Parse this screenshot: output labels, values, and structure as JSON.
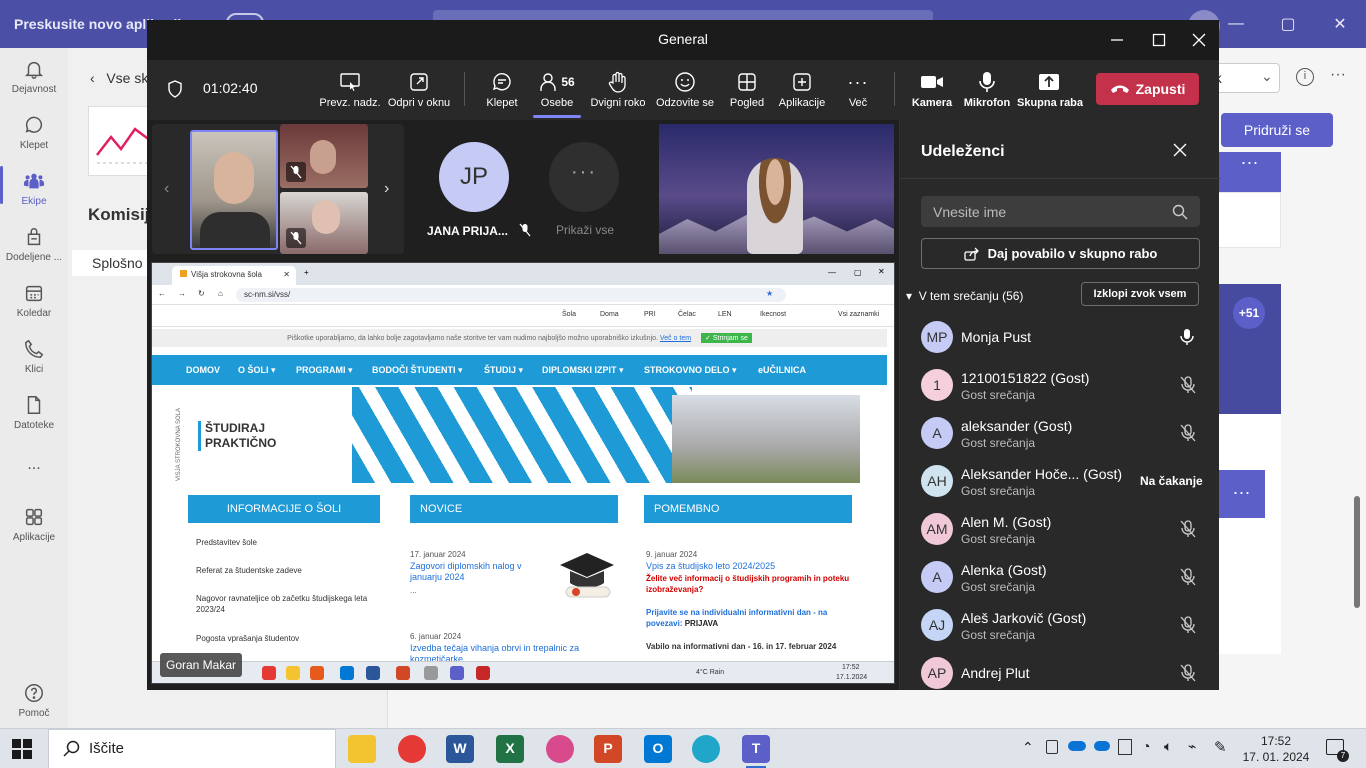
{
  "background": {
    "banner": "Preskusite novo aplikacijo",
    "rail": [
      {
        "label": "Dejavnost",
        "icon": "bell-icon"
      },
      {
        "label": "Klepet",
        "icon": "chat-icon"
      },
      {
        "label": "Ekipe",
        "icon": "teams-icon"
      },
      {
        "label": "Dodeljene ...",
        "icon": "assignments-icon"
      },
      {
        "label": "Koledar",
        "icon": "calendar-icon"
      },
      {
        "label": "Klici",
        "icon": "phone-icon"
      },
      {
        "label": "Datoteke",
        "icon": "file-icon"
      },
      {
        "label": "...",
        "icon": "more-icon"
      },
      {
        "label": "Aplikacije",
        "icon": "apps-icon"
      },
      {
        "label": "Pomoč",
        "icon": "help-icon"
      }
    ],
    "back_label": "Vse sk",
    "team_title": "Komisij",
    "channel_label": "Splošno",
    "right_btn_label": "ek",
    "join_label": "Pridruži se",
    "plus_count": "+51"
  },
  "meeting": {
    "window_title": "General",
    "timer": "01:02:40",
    "toolbar": {
      "take_control": "Prevz. nadz.",
      "pop_out": "Odpri v oknu",
      "chat": "Klepet",
      "people": "Osebe",
      "people_count": "56",
      "raise_hand": "Dvigni roko",
      "react": "Odzovite se",
      "view": "Pogled",
      "apps": "Aplikacije",
      "more": "Več",
      "camera": "Kamera",
      "mic": "Mikrofon",
      "share": "Skupna raba",
      "leave": "Zapusti"
    },
    "tiles": {
      "jp_initials": "JP",
      "jp_name": "JANA PRIJA...",
      "show_all": "Prikaži vse",
      "show_all_dots": "···"
    },
    "presenter_name": "Goran Makar",
    "shared_screen": {
      "tab_title": "Višja strokovna šola",
      "url": "sc-nm.si/vss/",
      "bookmarks": [
        "Šola",
        "Doma",
        "PRI",
        "Čelac",
        "LEN",
        "Ikecnost",
        "Vsi zaznamki"
      ],
      "cookie_text": "Piškotke uporabljamo, da lahko bolje zagotavljamo naše storitve ter vam nudimo najboljšo možno uporabniško izkušnjo.",
      "cookie_link": "Več o tem",
      "cookie_ok": "✓ Strinjam se",
      "nav": [
        "DOMOV",
        "O ŠOLI ▾",
        "PROGRAMI ▾",
        "BODOČI ŠTUDENTI ▾",
        "ŠTUDIJ ▾",
        "DIPLOMSKI IZPIT ▾",
        "STROKOVNO DELO ▾",
        "eUČILNICA"
      ],
      "hero_line1": "ŠTUDIRAJ",
      "hero_line2": "PRAKTIČNO",
      "hero_vertical": "VIŠJA STROKOVNA ŠOLA",
      "col1_title": "INFORMACIJE O ŠOLI",
      "col1_items": [
        "Predstavitev šole",
        "Referat za študentske zadeve",
        "Nagovor ravnateljice ob začetku študijskega leta 2023/24",
        "Pogosta vprašanja študentov"
      ],
      "col2_title": "NOVICE",
      "news": [
        {
          "date": "17. januar 2024",
          "title": "Zagovori diplomskih nalog v januarju 2024",
          "more": "..."
        },
        {
          "date": "6. januar 2024",
          "title": "Izvedba tečaja vihanja obrvi in trepalnic za kozmetičarke"
        }
      ],
      "col3_title": "POMEMBNO",
      "important": {
        "date": "9. januar 2024",
        "title": "Vpis za študijsko leto 2024/2025",
        "red": "Želite več informacij o študijskih programih in poteku izobraževanja?",
        "blue": "Prijavite se na individualni informativni dan - na povezavi:",
        "blue_link": "PRIJAVA",
        "bold": "Vabilo na informativni dan - 16. in 17. februar 2024"
      },
      "taskbar_weather": "4°C Rain",
      "taskbar_time": "17:52",
      "taskbar_date": "17.1.2024"
    },
    "participants_panel": {
      "title": "Udeleženci",
      "search_placeholder": "Vnesite ime",
      "invite": "Daj povabilo v skupno rabo",
      "section": "V tem srečanju (56)",
      "mute_all": "Izklopi zvok vsem",
      "people": [
        {
          "initials": "MP",
          "name": "Monja Pust",
          "sub": "",
          "status": "mic-on",
          "color": "#c5cbf5"
        },
        {
          "initials": "1",
          "name": "12100151822 (Gost)",
          "sub": "Gost srečanja",
          "status": "mic-off",
          "color": "#f5d0dc"
        },
        {
          "initials": "A",
          "name": "aleksander (Gost)",
          "sub": "Gost srečanja",
          "status": "mic-off",
          "color": "#c5cbf5"
        },
        {
          "initials": "AH",
          "name": "Aleksander Hoče... (Gost)",
          "sub": "Gost srečanja",
          "status": "Na čakanje",
          "color": "#d0e4f0"
        },
        {
          "initials": "AM",
          "name": "Alen M. (Gost)",
          "sub": "Gost srečanja",
          "status": "mic-off",
          "color": "#f0c8d8"
        },
        {
          "initials": "A",
          "name": "Alenka (Gost)",
          "sub": "Gost srečanja",
          "status": "mic-off",
          "color": "#c5cbf5"
        },
        {
          "initials": "AJ",
          "name": "Aleš Jarkovič (Gost)",
          "sub": "Gost srečanja",
          "status": "mic-off",
          "color": "#c5d5f5"
        },
        {
          "initials": "AP",
          "name": "Andrej Plut",
          "sub": "",
          "status": "mic-off",
          "color": "#f0c8d8"
        }
      ]
    }
  },
  "taskbar": {
    "search_label": "Iščite",
    "apps": [
      {
        "name": "file-explorer",
        "letter": "",
        "color": "#f4c430"
      },
      {
        "name": "chrome",
        "letter": "",
        "color": "#e53935"
      },
      {
        "name": "word",
        "letter": "W",
        "color": "#2b579a"
      },
      {
        "name": "excel",
        "letter": "X",
        "color": "#217346"
      },
      {
        "name": "snipping",
        "letter": "",
        "color": "#d84a8c"
      },
      {
        "name": "powerpoint",
        "letter": "P",
        "color": "#d24726"
      },
      {
        "name": "outlook",
        "letter": "O",
        "color": "#0078d4"
      },
      {
        "name": "edge",
        "letter": "",
        "color": "#1fa6c9"
      },
      {
        "name": "teams",
        "letter": "T",
        "color": "#5b5fc7"
      }
    ],
    "time": "17:52",
    "date": "17. 01. 2024"
  },
  "colors": {
    "teams_purple": "#5b5fc7",
    "leave_red": "#c4314b",
    "site_blue": "#1e9ad6"
  }
}
